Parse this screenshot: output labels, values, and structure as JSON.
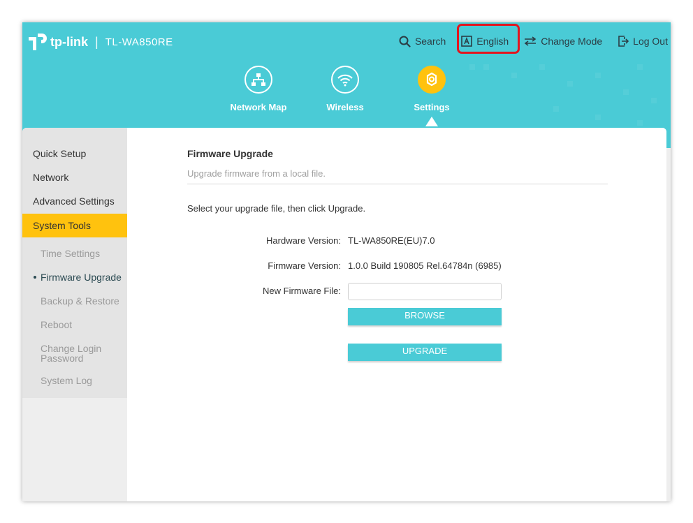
{
  "header": {
    "brand": "tp-link",
    "separator": "|",
    "model": "TL-WA850RE"
  },
  "topnav": {
    "search": "Search",
    "language": "English",
    "change_mode": "Change Mode",
    "logout": "Log Out"
  },
  "mainnav": {
    "network_map": "Network Map",
    "wireless": "Wireless",
    "settings": "Settings"
  },
  "sidebar": {
    "quick_setup": "Quick Setup",
    "network": "Network",
    "advanced_settings": "Advanced Settings",
    "system_tools": "System Tools",
    "sub": {
      "time_settings": "Time Settings",
      "firmware_upgrade": "Firmware Upgrade",
      "backup_restore": "Backup & Restore",
      "reboot": "Reboot",
      "change_login_password_1": "Change Login",
      "change_login_password_2": "Password",
      "system_log": "System Log"
    }
  },
  "main": {
    "title": "Firmware Upgrade",
    "description": "Upgrade firmware from a local file.",
    "instruction": "Select your upgrade file, then click Upgrade.",
    "hardware_label": "Hardware Version:",
    "hardware_value": "TL-WA850RE(EU)7.0",
    "firmware_label": "Firmware Version:",
    "firmware_value": "1.0.0 Build 190805 Rel.64784n (6985)",
    "new_file_label": "New Firmware File:",
    "new_file_value": "",
    "browse_button": "BROWSE",
    "upgrade_button": "UPGRADE"
  },
  "colors": {
    "header_bg": "#4acbd6",
    "accent_yellow": "#ffc20e",
    "highlight_red": "#e3141e"
  }
}
